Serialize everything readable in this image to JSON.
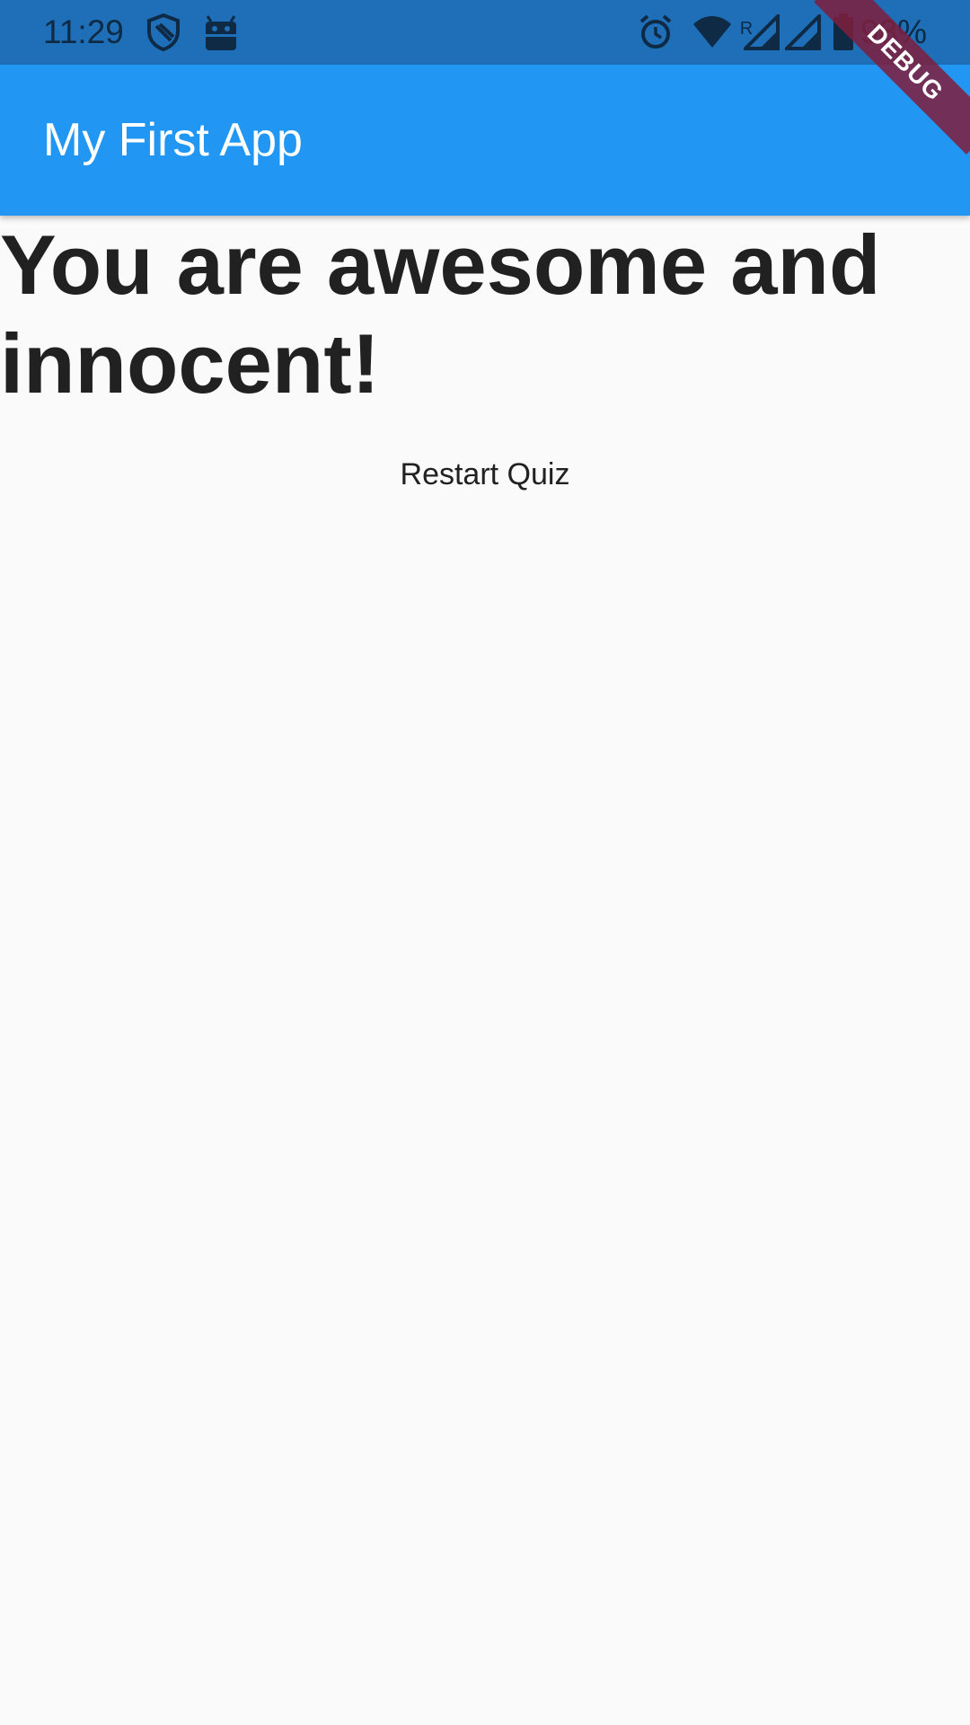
{
  "status_bar": {
    "time": "11:29",
    "battery_text": "98%",
    "icons": [
      "shield-icon",
      "android-icon",
      "alarm-icon",
      "wifi-icon",
      "signal-icon",
      "signal-icon",
      "battery-icon"
    ],
    "background": "#1e6fb8"
  },
  "app_bar": {
    "title": "My First App",
    "background": "#2196f3"
  },
  "debug_banner": {
    "label": "DEBUG"
  },
  "content": {
    "result_text": "You are awesome and innocent!",
    "restart_label": "Restart Quiz"
  }
}
